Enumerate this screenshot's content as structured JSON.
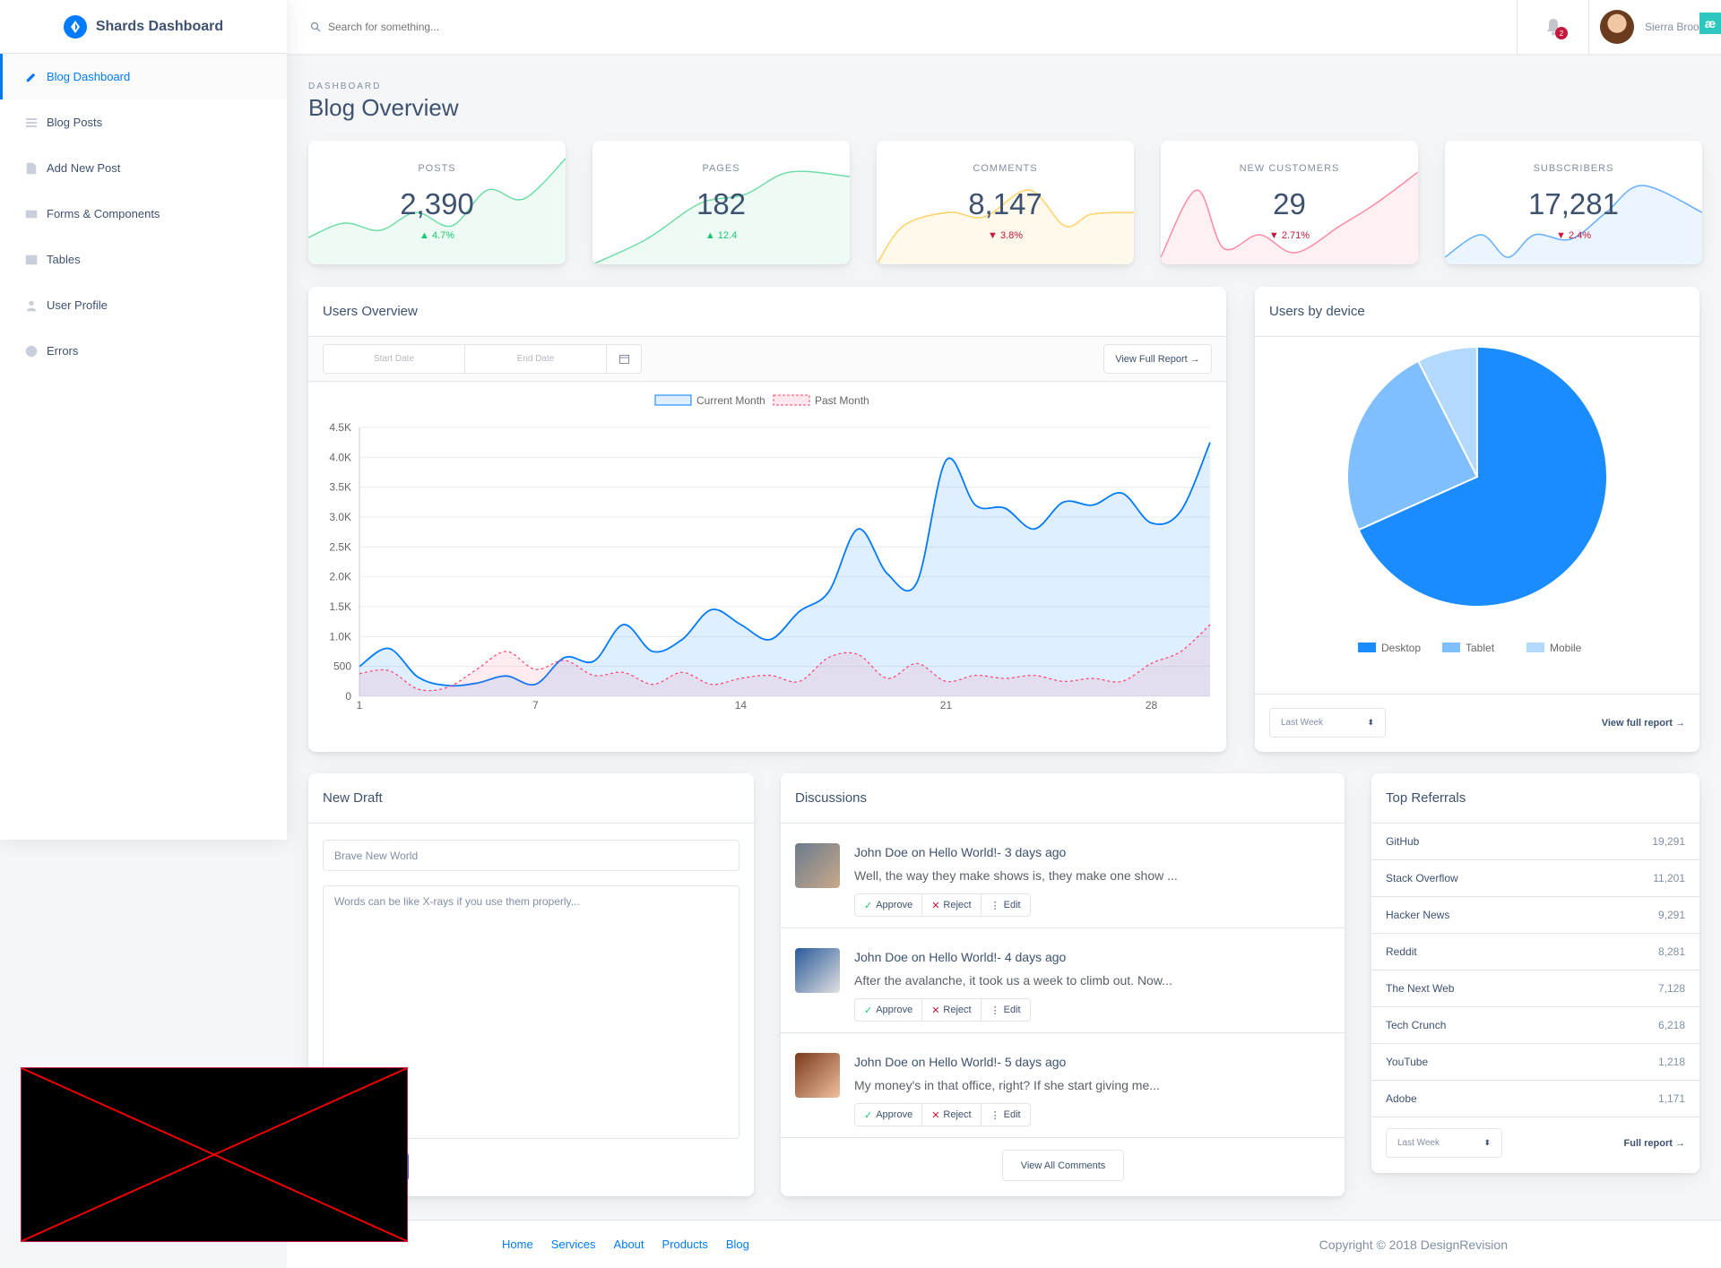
{
  "brand": {
    "name": "Shards Dashboard"
  },
  "sidebar": {
    "items": [
      {
        "label": "Blog Dashboard",
        "icon": "edit-icon",
        "active": true
      },
      {
        "label": "Blog Posts",
        "icon": "list-icon"
      },
      {
        "label": "Add New Post",
        "icon": "note-add-icon"
      },
      {
        "label": "Forms & Components",
        "icon": "forms-icon"
      },
      {
        "label": "Tables",
        "icon": "table-icon"
      },
      {
        "label": "User Profile",
        "icon": "person-icon"
      },
      {
        "label": "Errors",
        "icon": "error-icon"
      }
    ]
  },
  "topbar": {
    "search_placeholder": "Search for something...",
    "notifications_count": "2",
    "user_name": "Sierra Brooks",
    "corner_badge": "æ"
  },
  "page": {
    "subtitle": "DASHBOARD",
    "title": "Blog Overview"
  },
  "stats": [
    {
      "label": "POSTS",
      "value": "2,390",
      "change": "4.7%",
      "direction": "up",
      "color": "#17c671"
    },
    {
      "label": "PAGES",
      "value": "182",
      "change": "12.4",
      "direction": "up",
      "color": "#17c671"
    },
    {
      "label": "COMMENTS",
      "value": "8,147",
      "change": "3.8%",
      "direction": "down",
      "color": "#ffb400"
    },
    {
      "label": "NEW CUSTOMERS",
      "value": "29",
      "change": "2.71%",
      "direction": "down",
      "color": "#ff4169"
    },
    {
      "label": "SUBSCRIBERS",
      "value": "17,281",
      "change": "2.4%",
      "direction": "down",
      "color": "#007bff"
    }
  ],
  "users_overview": {
    "title": "Users Overview",
    "start_date_placeholder": "Start Date",
    "end_date_placeholder": "End Date",
    "view_report": "View Full Report →"
  },
  "users_by_device": {
    "title": "Users by device",
    "select": "Last Week",
    "view_report": "View full report →"
  },
  "new_draft": {
    "title": "New Draft",
    "title_placeholder": "Brave New World",
    "body_placeholder": "Words can be like X-rays if you use them properly..."
  },
  "discussions": {
    "title": "Discussions",
    "items": [
      {
        "title": "John Doe on Hello World!- 3 days ago",
        "text": "Well, the way they make shows is, they make one show ..."
      },
      {
        "title": "John Doe on Hello World!- 4 days ago",
        "text": "After the avalanche, it took us a week to climb out. Now..."
      },
      {
        "title": "John Doe on Hello World!- 5 days ago",
        "text": "My money's in that office, right? If she start giving me..."
      }
    ],
    "approve": "Approve",
    "reject": "Reject",
    "edit": "Edit",
    "view_all": "View All Comments"
  },
  "top_referrals": {
    "title": "Top Referrals",
    "rows": [
      {
        "name": "GitHub",
        "count": "19,291"
      },
      {
        "name": "Stack Overflow",
        "count": "11,201"
      },
      {
        "name": "Hacker News",
        "count": "9,291"
      },
      {
        "name": "Reddit",
        "count": "8,281"
      },
      {
        "name": "The Next Web",
        "count": "7,128"
      },
      {
        "name": "Tech Crunch",
        "count": "6,218"
      },
      {
        "name": "YouTube",
        "count": "1,218"
      },
      {
        "name": "Adobe",
        "count": "1,171"
      }
    ],
    "select": "Last Week",
    "full_report": "Full report →"
  },
  "footer": {
    "links": [
      "Home",
      "Services",
      "About",
      "Products",
      "Blog"
    ],
    "copyright": "Copyright © 2018 DesignRevision"
  },
  "chart_data": [
    {
      "type": "area",
      "legend": [
        "Current Month",
        "Past Month"
      ],
      "x": [
        1,
        2,
        3,
        4,
        5,
        6,
        7,
        8,
        9,
        10,
        11,
        12,
        13,
        14,
        15,
        16,
        17,
        18,
        19,
        20,
        21,
        22,
        23,
        24,
        25,
        26,
        27,
        28,
        29,
        30
      ],
      "x_ticks": [
        1,
        7,
        14,
        21,
        28
      ],
      "ylim": [
        0,
        4500
      ],
      "y_ticks": [
        "0",
        "500",
        "1.0K",
        "1.5K",
        "2.0K",
        "2.5K",
        "3.0K",
        "3.5K",
        "4.0K",
        "4.5K"
      ],
      "series": [
        {
          "name": "Current Month",
          "color": "#007bff",
          "values": [
            500,
            800,
            320,
            180,
            220,
            340,
            200,
            650,
            590,
            1200,
            750,
            950,
            1450,
            1200,
            950,
            1420,
            1750,
            2800,
            2050,
            1900,
            3950,
            3200,
            3150,
            2800,
            3250,
            3200,
            3400,
            2900,
            3100,
            4250
          ]
        },
        {
          "name": "Past Month",
          "color": "#ff4169",
          "values": [
            380,
            430,
            120,
            150,
            450,
            750,
            450,
            600,
            350,
            400,
            200,
            400,
            200,
            300,
            350,
            250,
            650,
            700,
            300,
            550,
            250,
            350,
            300,
            350,
            250,
            300,
            250,
            550,
            750,
            1200
          ]
        }
      ]
    },
    {
      "type": "pie",
      "categories": [
        "Desktop",
        "Tablet",
        "Mobile"
      ],
      "values": [
        68.3,
        24.2,
        7.5
      ],
      "colors": [
        "#1a8cff",
        "#80bfff",
        "#b3d9ff"
      ]
    }
  ]
}
